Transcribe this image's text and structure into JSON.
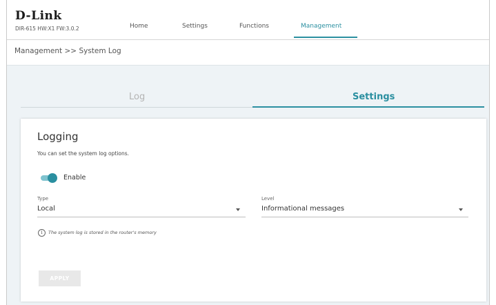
{
  "header": {
    "logo": "D-Link",
    "model": "DIR-615 HW:X1 FW:3.0.2",
    "nav": [
      {
        "label": "Home"
      },
      {
        "label": "Settings"
      },
      {
        "label": "Functions"
      },
      {
        "label": "Management",
        "active": true
      }
    ],
    "accent_color": "#2a8fa0"
  },
  "breadcrumb": "Management >> System Log",
  "tabs": [
    {
      "label": "Log",
      "active": false
    },
    {
      "label": "Settings",
      "active": true
    }
  ],
  "card": {
    "title": "Logging",
    "description": "You can set the system log options.",
    "enable": {
      "label": "Enable",
      "on": true
    },
    "type": {
      "label": "Type",
      "value": "Local"
    },
    "level": {
      "label": "Level",
      "value": "Informational messages"
    },
    "info_icon": "info-icon",
    "info": "The system log is stored in the router's memory",
    "apply_label": "APPLY"
  }
}
